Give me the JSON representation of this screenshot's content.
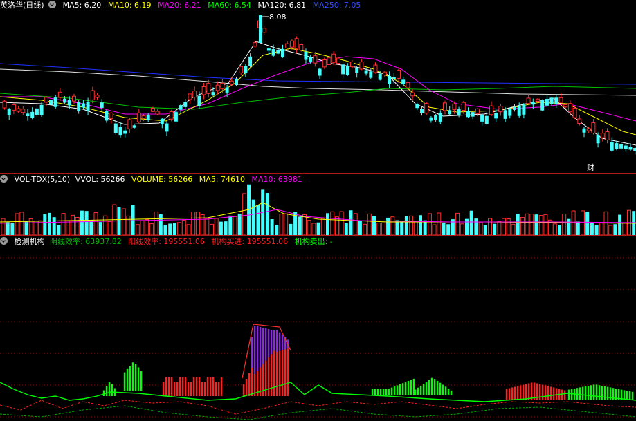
{
  "main_header": {
    "stock_name": "英洛华(日线)",
    "ma_items": [
      {
        "label": "MA5: 6.20",
        "color": "#ffffff"
      },
      {
        "label": "MA10: 6.19",
        "color": "#ffff00"
      },
      {
        "label": "MA20: 6.21",
        "color": "#ff00ff"
      },
      {
        "label": "MA60: 6.54",
        "color": "#00ff00"
      },
      {
        "label": "MA120: 6.81",
        "color": "#ffffff"
      },
      {
        "label": "MA250: 7.05",
        "color": "#0000ff"
      }
    ],
    "high_marker": "8.08",
    "fin_marker": "财"
  },
  "vol_header": {
    "name": "VOL-TDX(5,10)",
    "items": [
      {
        "label": "VVOL: 56266",
        "color": "#ffffff"
      },
      {
        "label": "VOLUME: 56266",
        "color": "#ffff00"
      },
      {
        "label": "MA5: 74610",
        "color": "#ffff00"
      },
      {
        "label": "MA10: 63981",
        "color": "#ff00ff"
      }
    ]
  },
  "ind_header": {
    "name": "检测机构",
    "items": [
      {
        "label": "阴线效率: 63937.82",
        "color": "#00cc00"
      },
      {
        "label": "阳线效率: 195551.06",
        "color": "#ff2020"
      },
      {
        "label": "机构买进: 195551.06",
        "color": "#ff2020"
      },
      {
        "label": "机构卖出: -",
        "color": "#00ff00"
      }
    ]
  },
  "colors": {
    "up": "#ff3030",
    "down": "#44ffff",
    "bg": "#000000",
    "grid": "#b01818"
  }
}
